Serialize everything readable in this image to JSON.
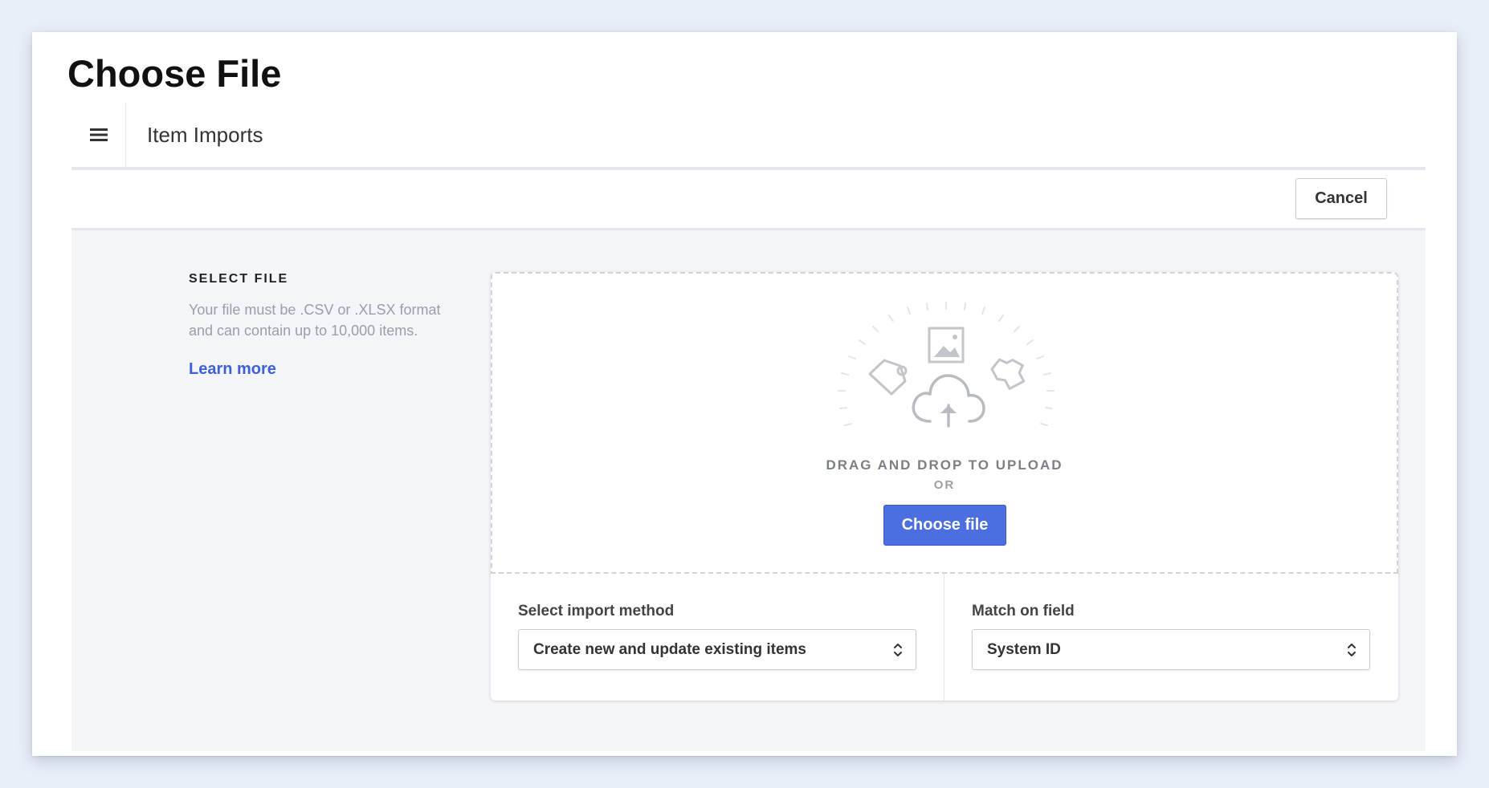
{
  "page": {
    "title": "Choose File"
  },
  "header": {
    "menu_icon": "hamburger-menu-icon",
    "app_title": "Item Imports"
  },
  "toolbar": {
    "cancel_label": "Cancel"
  },
  "select_file": {
    "heading": "SELECT FILE",
    "description": "Your file must be .CSV or .XLSX format and can contain up to 10,000 items.",
    "learn_more": "Learn more"
  },
  "upload": {
    "illustration_icons": [
      "image-icon",
      "tag-icon",
      "cloud-upload-icon",
      "shirt-icon"
    ],
    "drag_text": "DRAG AND DROP TO UPLOAD",
    "or_text": "OR",
    "choose_button": "Choose file"
  },
  "import_method": {
    "label": "Select import method",
    "value": "Create new and update existing items"
  },
  "match_field": {
    "label": "Match on field",
    "value": "System ID"
  },
  "colors": {
    "accent": "#4b6ee0",
    "link": "#3d5fd9",
    "background": "#e9eff9",
    "content_background": "#f4f5f8"
  }
}
